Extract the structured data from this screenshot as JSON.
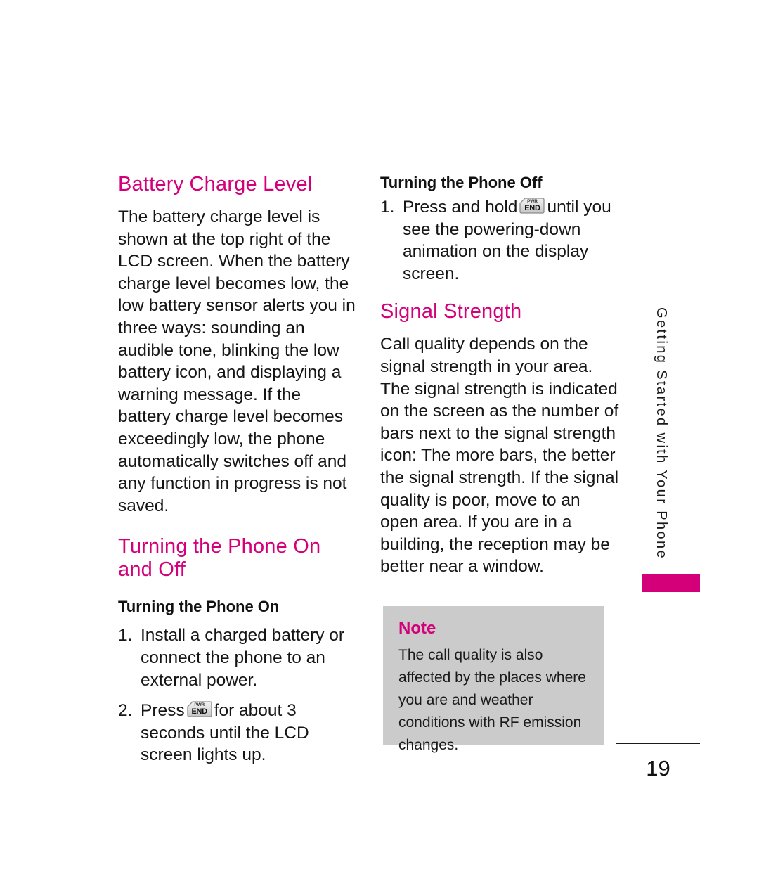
{
  "page": {
    "number": "19",
    "side_tab_label": "Getting Started with Your Phone",
    "accent_color": "#d4007a",
    "note_bg_color": "#cbcbcb"
  },
  "key_icon": {
    "top_label": "PWR",
    "bottom_label": "END"
  },
  "left_column": {
    "heading_1": "Battery Charge Level",
    "paragraph_1": "The battery charge level is shown at the top right of the LCD screen. When the battery charge level becomes low, the low battery sensor alerts you in three ways: sounding an audible tone, blinking the low battery icon, and displaying a warning message. If the battery charge level becomes exceedingly low, the phone automatically switches off and any function in progress is not saved.",
    "heading_2": "Turning the Phone On and Off",
    "subheading_1": "Turning the Phone On",
    "steps": [
      {
        "number": "1.",
        "text_before": "Install a charged battery or connect the phone to an external power.",
        "has_key": false,
        "text_after": ""
      },
      {
        "number": "2.",
        "text_before": "Press",
        "has_key": true,
        "text_after": "for about 3 seconds until the LCD screen lights up."
      }
    ]
  },
  "right_column": {
    "subheading_1": "Turning the Phone Off",
    "steps": [
      {
        "number": "1.",
        "text_before": "Press and hold",
        "has_key": true,
        "text_after": "until you see the powering-down animation on the display screen."
      }
    ],
    "heading_1": "Signal Strength",
    "paragraph_1": "Call quality depends on the signal strength in your area. The signal strength is indicated on the screen as the number of bars next to the signal strength icon: The more bars, the better the signal strength. If the signal quality is poor, move to an open area. If you are in a building, the reception may be better near a window.",
    "note": {
      "title": "Note",
      "body": "The call quality is also affected by the places where you are and weather conditions with RF emission changes."
    }
  }
}
